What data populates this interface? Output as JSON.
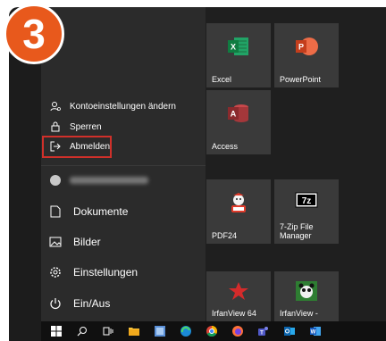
{
  "step_badge": {
    "number": "3"
  },
  "account_menu": {
    "items": [
      {
        "label": "Kontoeinstellungen ändern",
        "icon": "account-settings-icon"
      },
      {
        "label": "Sperren",
        "icon": "lock-icon"
      },
      {
        "label": "Abmelden",
        "icon": "sign-out-icon"
      }
    ],
    "highlighted_item": "Abmelden"
  },
  "sidebar": {
    "user": {
      "icon": "user-avatar-icon"
    },
    "items": [
      {
        "label": "Dokumente",
        "icon": "document-icon"
      },
      {
        "label": "Bilder",
        "icon": "pictures-icon"
      },
      {
        "label": "Einstellungen",
        "icon": "gear-icon"
      },
      {
        "label": "Ein/Aus",
        "icon": "power-icon"
      }
    ]
  },
  "tiles": [
    {
      "label": "Excel",
      "icon": "excel-icon",
      "color": "#1d6f42"
    },
    {
      "label": "PowerPoint",
      "icon": "powerpoint-icon",
      "color": "#c43e1c"
    },
    {
      "label": "Access",
      "icon": "access-icon",
      "color": "#a4373a"
    },
    {
      "label": "PDF24",
      "icon": "pdf24-icon"
    },
    {
      "label": "7-Zip File Manager",
      "icon": "7zip-icon"
    },
    {
      "label": "IrfanView 64",
      "icon": "irfanview-icon"
    },
    {
      "label": "IrfanView -",
      "icon": "irfanview-thumbnails-icon"
    }
  ],
  "taskbar": {
    "icons": [
      "windows-start-icon",
      "search-icon",
      "task-view-icon",
      "file-explorer-icon",
      "control-panel-icon",
      "edge-icon",
      "chrome-icon",
      "firefox-icon",
      "teams-icon",
      "outlook-icon",
      "word-icon"
    ]
  },
  "colors": {
    "highlight_border": "#d0302a",
    "badge": "#e8591c"
  }
}
